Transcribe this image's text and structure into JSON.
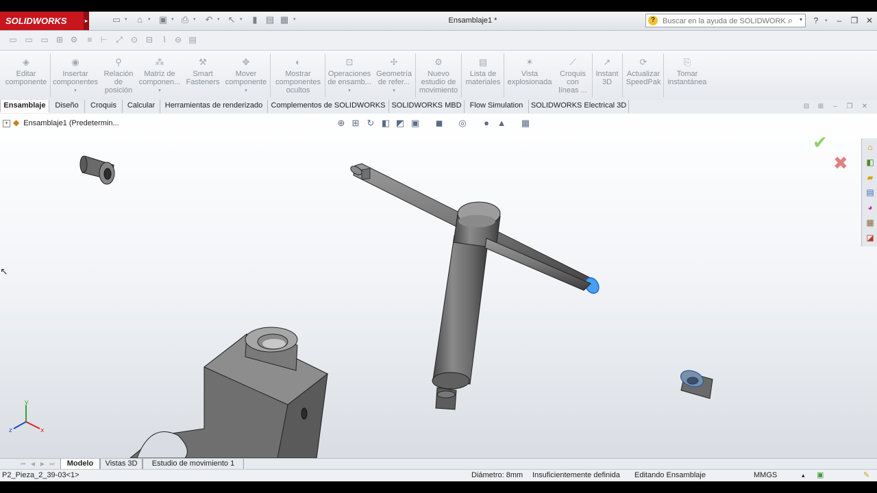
{
  "app": {
    "brand": "SOLIDWORKS",
    "document_title": "Ensamblaje1 *",
    "search_placeholder": "Buscar en la ayuda de SOLIDWORKS"
  },
  "command_manager": [
    {
      "label": "Editar\ncomponente",
      "icon": "edit-component-icon",
      "dropdown": false
    },
    {
      "label": "Insertar\ncomponentes",
      "icon": "insert-components-icon",
      "dropdown": true
    },
    {
      "label": "Relación\nde\nposición",
      "icon": "mate-icon",
      "dropdown": false
    },
    {
      "label": "Matriz de\ncomponen...",
      "icon": "pattern-icon",
      "dropdown": true
    },
    {
      "label": "Smart\nFasteners",
      "icon": "smart-fasteners-icon",
      "dropdown": false
    },
    {
      "label": "Mover\ncomponente",
      "icon": "move-component-icon",
      "dropdown": true
    },
    {
      "label": "Mostrar\ncomponentes\nocultos",
      "icon": "show-hidden-icon",
      "dropdown": false
    },
    {
      "label": "Operaciones\nde ensamb...",
      "icon": "assembly-features-icon",
      "dropdown": true
    },
    {
      "label": "Geometría\nde refer...",
      "icon": "reference-geometry-icon",
      "dropdown": true
    },
    {
      "label": "Nuevo\nestudio de\nmovimiento",
      "icon": "motion-study-icon",
      "dropdown": false
    },
    {
      "label": "Lista de\nmateriales",
      "icon": "bom-icon",
      "dropdown": false
    },
    {
      "label": "Vista\nexplosionada",
      "icon": "exploded-view-icon",
      "dropdown": false
    },
    {
      "label": "Croquis\ncon\nlíneas ...",
      "icon": "explode-line-sketch-icon",
      "dropdown": false
    },
    {
      "label": "Instant\n3D",
      "icon": "instant3d-icon",
      "dropdown": false
    },
    {
      "label": "Actualizar\nSpeedPak",
      "icon": "speedpak-icon",
      "dropdown": false
    },
    {
      "label": "Tomar\ninstantánea",
      "icon": "snapshot-icon",
      "dropdown": false
    }
  ],
  "tabs": [
    "Ensamblaje",
    "Diseño",
    "Croquis",
    "Calcular",
    "Herramientas de renderizado",
    "Complementos de SOLIDWORKS",
    "SOLIDWORKS MBD",
    "Flow Simulation",
    "SOLIDWORKS Electrical 3D"
  ],
  "active_tab": "Ensamblaje",
  "feature_tree": {
    "root_label": "Ensamblaje1  (Predetermin..."
  },
  "bottom_tabs": [
    "Modelo",
    "Vistas 3D",
    "Estudio de movimiento 1"
  ],
  "active_bottom_tab": "Modelo",
  "triad": {
    "x_label": "x",
    "y_label": "y",
    "z_label": "z"
  },
  "status_bar": {
    "selection": "P2_Pieza_2_39-03<1>",
    "measurement": "Diámetro: 8mm",
    "definition": "Insuficientemente definida",
    "mode": "Editando Ensamblaje",
    "units": "MMGS"
  },
  "colors": {
    "brand_red": "#c8161e",
    "selected_face": "#3b8fe0",
    "part_gray": "#6e6e6e",
    "confirm_green": "#8fd16a",
    "cancel_red": "#e08080"
  }
}
